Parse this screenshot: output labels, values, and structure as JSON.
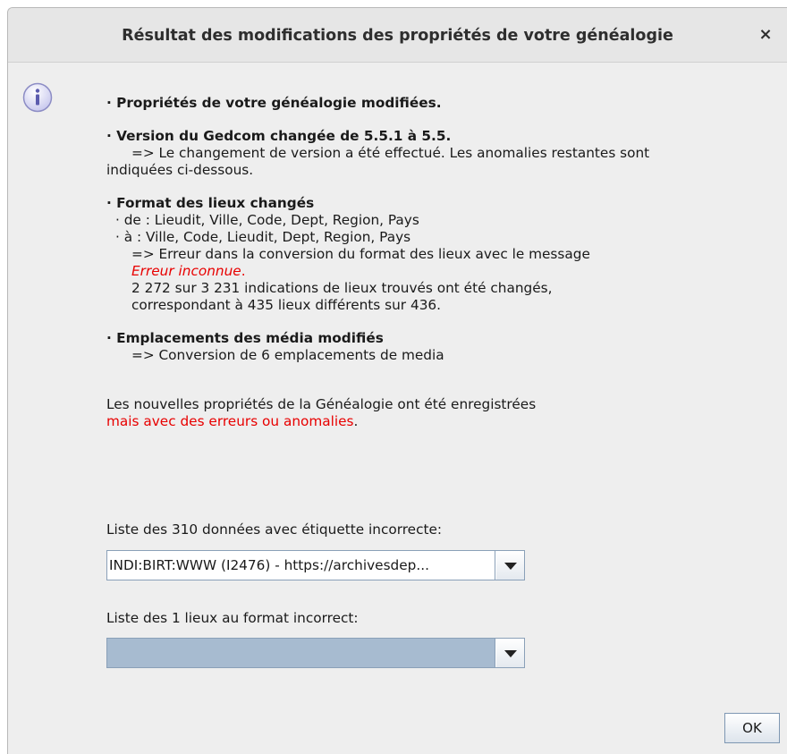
{
  "dialog": {
    "title": "Résultat des modifications des propriétés de votre généalogie",
    "close_glyph": "×",
    "icon": "info-icon"
  },
  "messages": {
    "line1": "· Propriétés de votre généalogie modifiées.",
    "gedcom_title": "· Version du Gedcom changée de 5.5.1 à 5.5.",
    "gedcom_result_a": "=> Le changement de version a été effectué. Les anomalies restantes sont",
    "gedcom_result_b": "indiquées ci-dessous.",
    "places_title": "· Format des lieux changés",
    "places_from": "· de : Lieudit, Ville, Code, Dept, Region, Pays",
    "places_to": "· à : Ville, Code, Lieudit, Dept, Region, Pays",
    "places_error": "=> Erreur dans la conversion du format des lieux avec le message",
    "places_error_msg": "Erreur inconnue",
    "places_error_period": ".",
    "places_count_a": "2 272 sur 3 231 indications de lieux trouvés ont été changés,",
    "places_count_b": "correspondant à 435 lieux différents sur 436.",
    "media_title": "· Emplacements des média modifiés",
    "media_result": "=> Conversion de 6 emplacements de media",
    "saved_a": "Les nouvelles propriétés de la Généalogie ont été enregistrées",
    "saved_b": "mais avec des erreurs ou anomalies",
    "saved_b_period": "."
  },
  "tag_list": {
    "label": "Liste des 310 données avec étiquette incorrecte:",
    "selected": "INDI:BIRT:WWW (I2476) - https://archivesdep..."
  },
  "place_list": {
    "label": "Liste des 1 lieux au format incorrect:",
    "selected": ""
  },
  "buttons": {
    "ok": "OK"
  },
  "colors": {
    "error_red": "#e80000",
    "window_bg": "#eeeeee",
    "combo_empty_bg": "#a7bbd0"
  }
}
